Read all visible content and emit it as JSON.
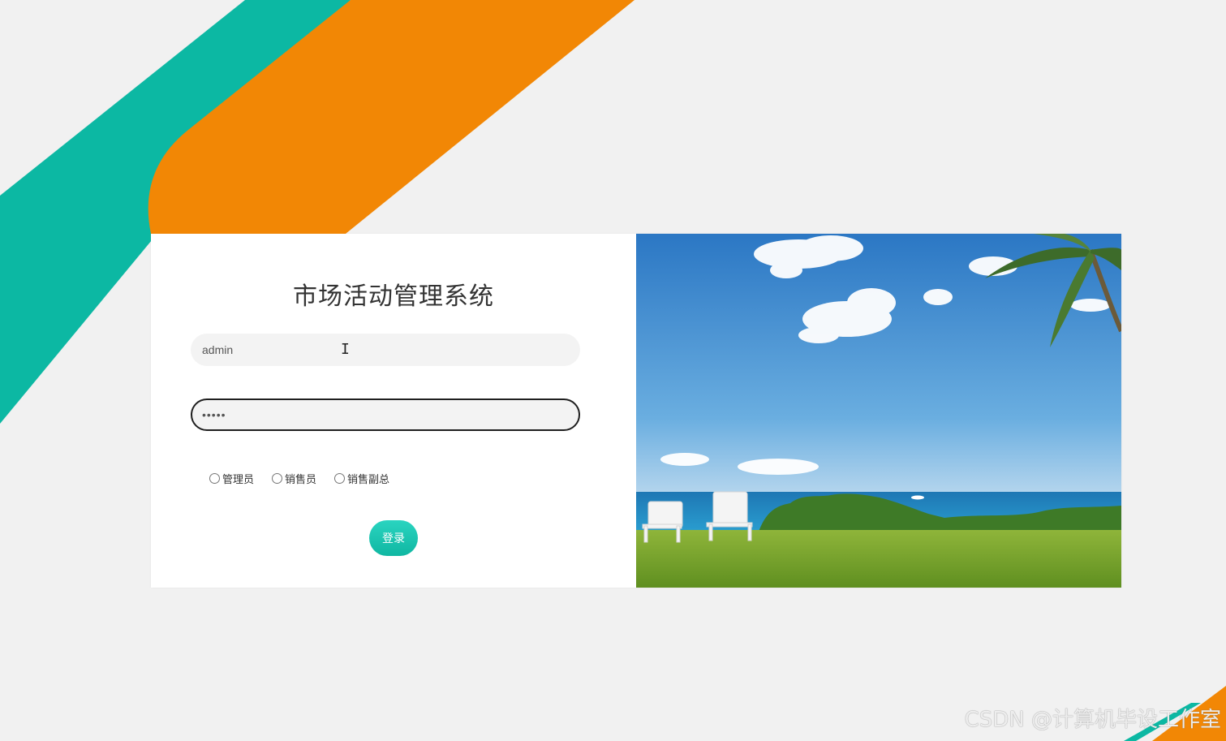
{
  "login": {
    "title": "市场活动管理系统",
    "username_value": "admin",
    "password_value": "•••••",
    "roles": [
      {
        "label": "管理员"
      },
      {
        "label": "销售员"
      },
      {
        "label": "销售副总"
      }
    ],
    "login_button_label": "登录"
  },
  "watermark": {
    "text": "CSDN @计算机毕设工作室"
  },
  "colors": {
    "teal": "#0cb8a3",
    "orange": "#f28705",
    "page_background": "#f1f1f1"
  }
}
